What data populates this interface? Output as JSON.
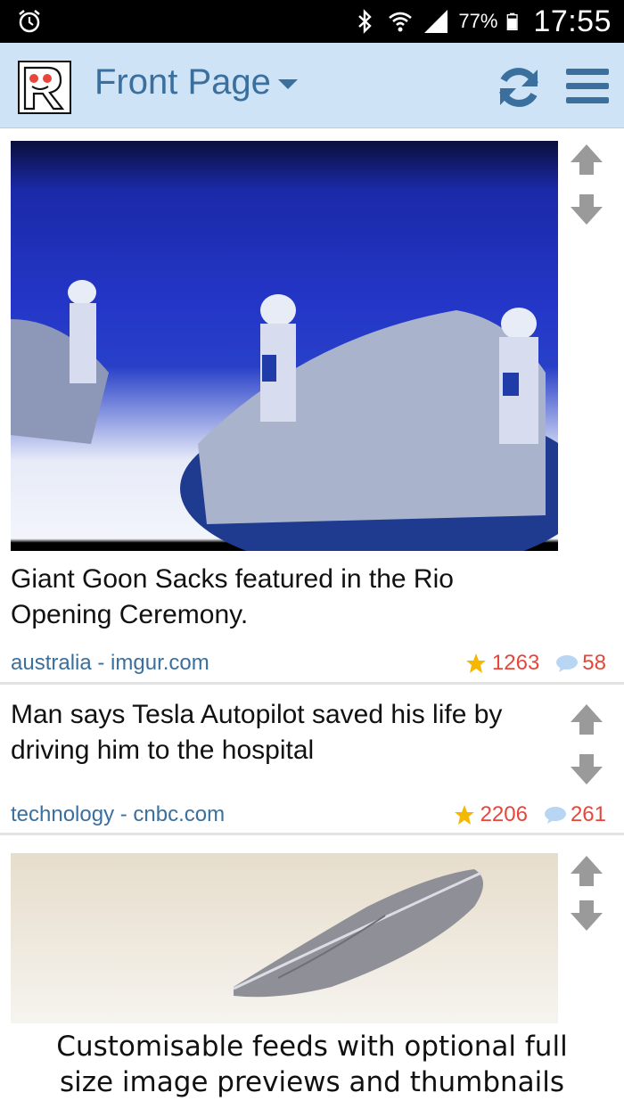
{
  "status_bar": {
    "battery_percent": "77%",
    "time": "17:55",
    "icons": [
      "alarm-icon",
      "bluetooth-icon",
      "wifi-icon",
      "signal-icon",
      "battery-icon"
    ]
  },
  "app_bar": {
    "title": "Front Page",
    "icons": [
      "app-logo",
      "refresh-icon",
      "menu-icon"
    ],
    "accent_color": "#3a6f9e",
    "background_color": "#cfe3f6"
  },
  "posts": [
    {
      "title": "Giant Goon Sacks featured in the Rio Opening Ceremony.",
      "subreddit": "australia",
      "domain": "imgur.com",
      "meta": "australia - imgur.com",
      "score": "1263",
      "comments": "58",
      "has_image": true,
      "image_description": "stadium performers"
    },
    {
      "title": "Man says Tesla Autopilot saved his life by driving him to the hospital",
      "subreddit": "technology",
      "domain": "cnbc.com",
      "meta": "technology - cnbc.com",
      "score": "2206",
      "comments": "261",
      "has_image": false
    },
    {
      "has_image": true,
      "image_description": "feather"
    }
  ],
  "caption": {
    "line1": "Customisable feeds with optional full",
    "line2": "size image previews and thumbnails"
  },
  "colors": {
    "score": "#e8463a",
    "star": "#f5b800",
    "comment_bubble": "#b8d6f3",
    "vote_arrow": "#9a9a9a"
  }
}
